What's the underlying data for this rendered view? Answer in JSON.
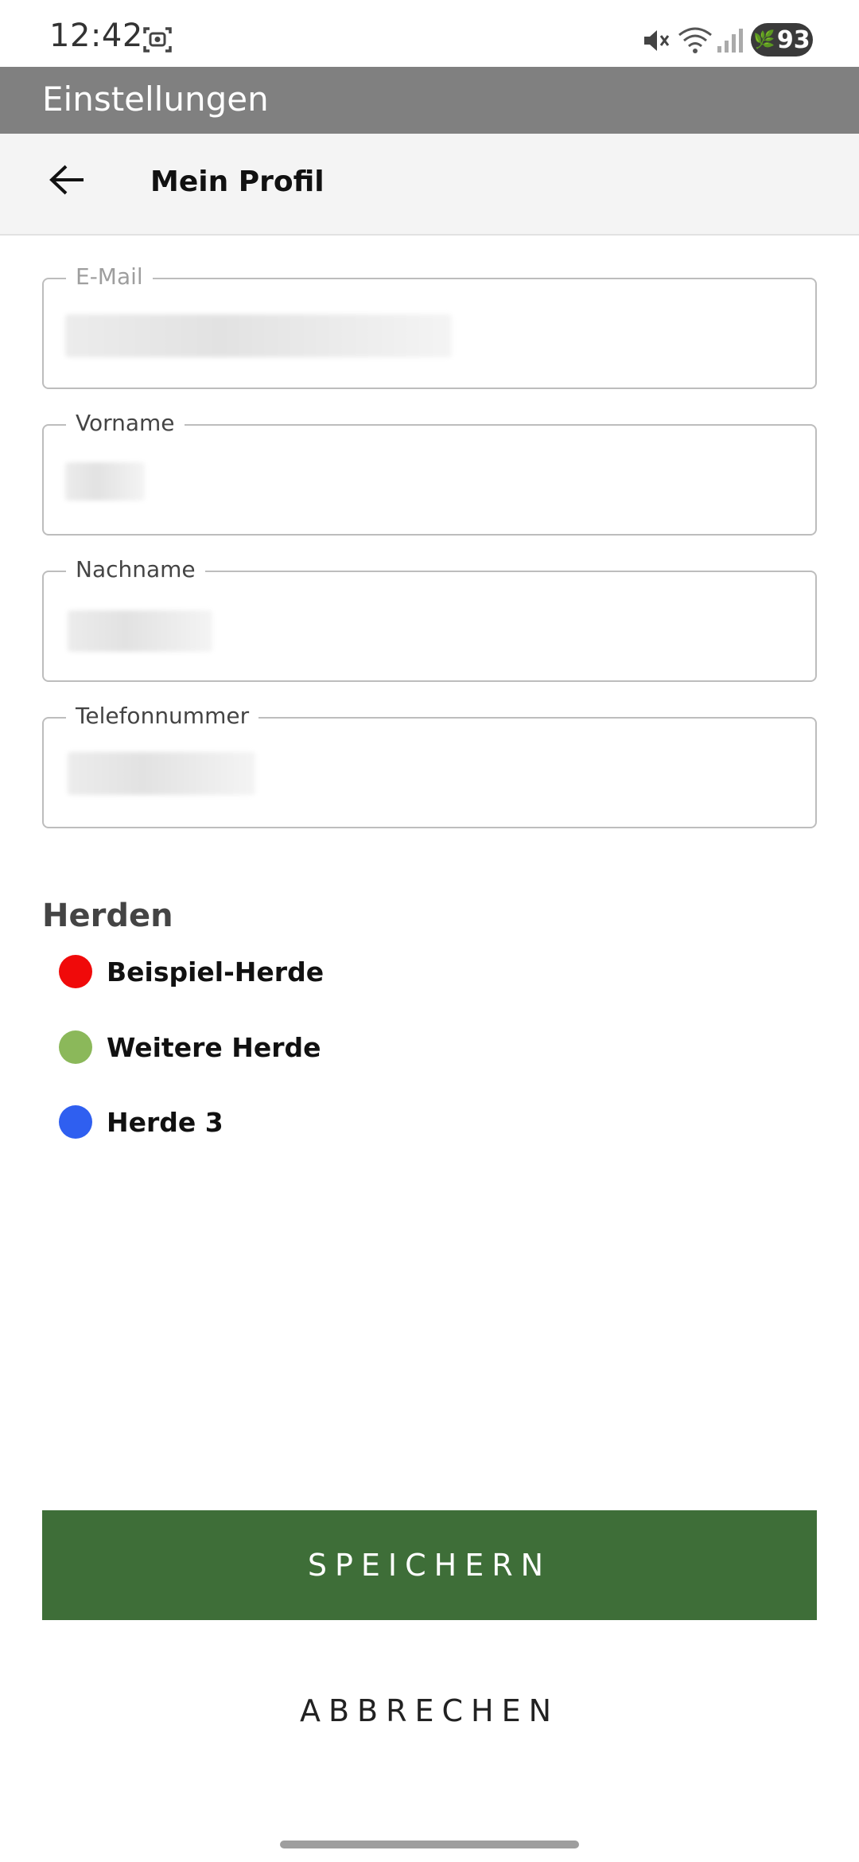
{
  "status_bar": {
    "time": "12:42",
    "battery": "93",
    "icons": [
      "screenshot-icon",
      "mute-icon",
      "wifi-icon",
      "signal-icon",
      "battery-icon"
    ]
  },
  "app_bar": {
    "title": "Einstellungen"
  },
  "header": {
    "title": "Mein Profil",
    "back_icon": "arrow-left-icon"
  },
  "form": {
    "email_label": "E-Mail",
    "firstname_label": "Vorname",
    "lastname_label": "Nachname",
    "phone_label": "Telefonnummer"
  },
  "herds": {
    "title": "Herden",
    "items": [
      {
        "label": "Beispiel-Herde",
        "color": "#f00a0a"
      },
      {
        "label": "Weitere Herde",
        "color": "#8bb85a"
      },
      {
        "label": "Herde 3",
        "color": "#2f5ff0"
      }
    ]
  },
  "actions": {
    "save_label": "SPEICHERN",
    "cancel_label": "ABBRECHEN"
  },
  "colors": {
    "app_bar": "#808080",
    "primary_button": "#3e6e38"
  }
}
